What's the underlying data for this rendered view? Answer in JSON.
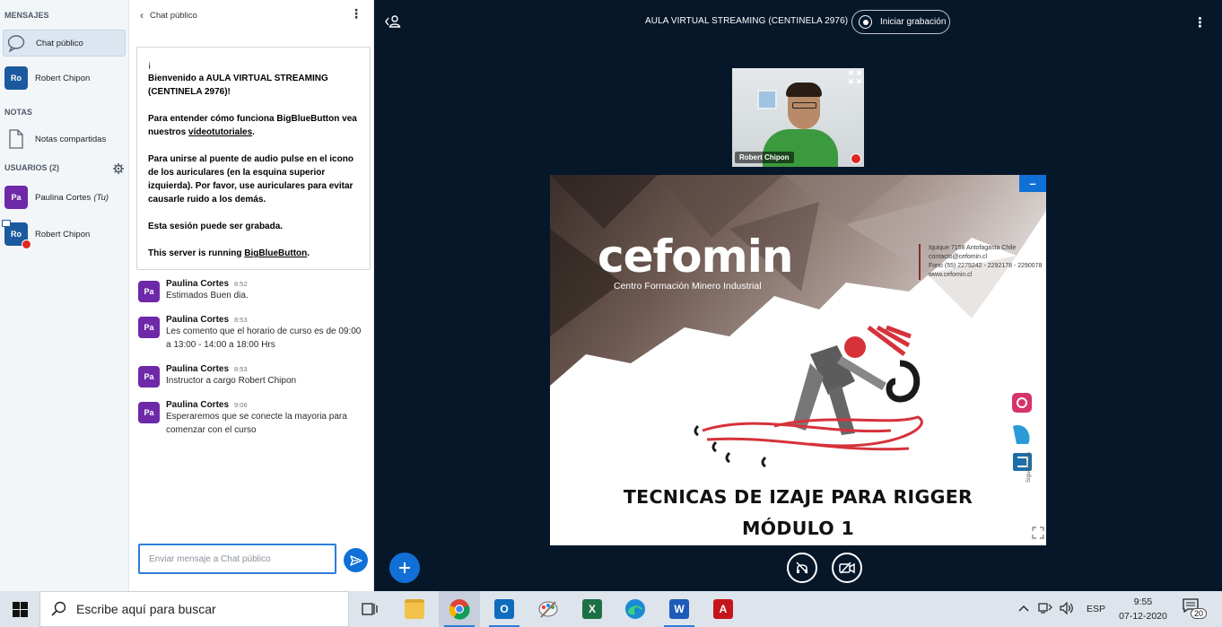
{
  "nav": {
    "messages_header": "MENSAJES",
    "public_chat_label": "Chat público",
    "private_user_label": "Robert Chipon",
    "private_user_initials": "Ro",
    "notes_header": "NOTAS",
    "shared_notes_label": "Notas compartidas",
    "users_header": "USUARIOS (2)",
    "users": [
      {
        "initials": "Pa",
        "name": "Paulina Cortes",
        "tag": "(Tu)",
        "color": "#6e29a8"
      },
      {
        "initials": "Ro",
        "name": "Robert Chipon",
        "tag": "",
        "color": "#1b5a9e"
      }
    ]
  },
  "chat": {
    "header": "Chat público",
    "welcome": {
      "line_open": "¡",
      "line1_prefix": "Bienvenido a ",
      "line1_bold": "AULA VIRTUAL STREAMING (CENTINELA 2976)",
      "line1_suffix": "!",
      "p2_text": "Para entender cómo funciona BigBlueButton vea nuestros ",
      "p2_link": "vídeotutoriales",
      "p2_end": ".",
      "p3": "Para unirse al puente de audio pulse en el icono de los auriculares (en la esquina superior izquierda). Por favor, use auriculares para evitar causarle ruido a los demás.",
      "p4": "Esta sesión puede ser grabada.",
      "p5_text": "This server is running ",
      "p5_link": "BigBlueButton",
      "p5_end": "."
    },
    "messages": [
      {
        "initials": "Pa",
        "name": "Paulina Cortes",
        "time": "8:52",
        "text": "Estimados Buen dia."
      },
      {
        "initials": "Pa",
        "name": "Paulina Cortes",
        "time": "8:53",
        "text": "Les comento que el horario de curso es de 09:00 a 13:00 - 14:00 a 18:00 Hrs"
      },
      {
        "initials": "Pa",
        "name": "Paulina Cortes",
        "time": "8:53",
        "text": "Instructor a cargo Robert Chipon"
      },
      {
        "initials": "Pa",
        "name": "Paulina Cortes",
        "time": "9:06",
        "text": "Esperaremos que se conecte la mayoria para comenzar con el curso"
      }
    ],
    "input_placeholder": "Enviar mensaje a Chat público"
  },
  "main": {
    "title": "AULA VIRTUAL STREAMING (CENTINELA 2976)",
    "record_label": "Iniciar grabación",
    "webcam_name": "Robert Chipon",
    "slide": {
      "brand": "cefomin",
      "brand_sub": "Centro Formación Minero Industrial",
      "contact_lines": [
        "Iquique 7158 Antofagasta Chile",
        "contacto@cefomin.cl",
        "Fono (55) 2275242 - 2292178 - 2290078",
        "www.cefomin.cl"
      ],
      "title_line1": "TECNICAS DE IZAJE PARA RIGGER",
      "title_line2": "MÓDULO 1",
      "follow_us": "Síguenos en"
    }
  },
  "taskbar": {
    "search_placeholder": "Escribe aquí para buscar",
    "language": "ESP",
    "time": "9:55",
    "date": "07-12-2020",
    "notification_count": "20"
  },
  "colors": {
    "accent": "#0f70d7",
    "user_purple": "#6e29a8",
    "main_bg": "#06172a",
    "muted_red": "#df2721"
  }
}
